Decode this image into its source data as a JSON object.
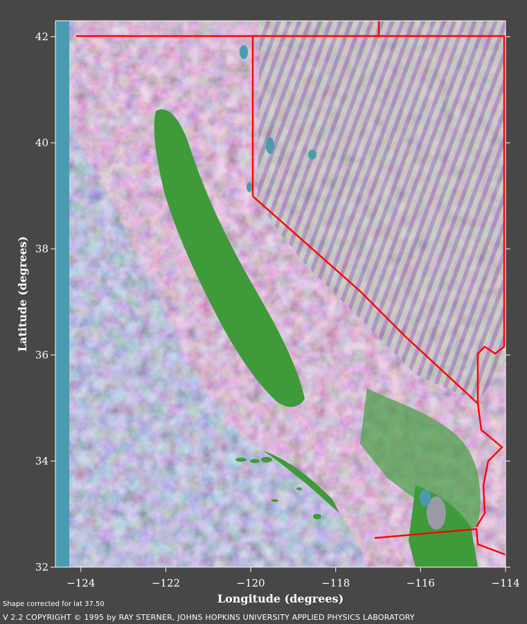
{
  "map": {
    "x_label": "Longitude (degrees)",
    "y_label": "Latitude (degrees)",
    "lon_range": [
      -124.6,
      -114.0
    ],
    "lat_range": [
      32.0,
      42.3
    ],
    "x_ticks": [
      {
        "value": -124,
        "label": "−124"
      },
      {
        "value": -122,
        "label": "−122"
      },
      {
        "value": -120,
        "label": "−120"
      },
      {
        "value": -118,
        "label": "−118"
      },
      {
        "value": -116,
        "label": "−116"
      },
      {
        "value": -114,
        "label": "−114"
      }
    ],
    "y_ticks": [
      {
        "value": 42,
        "label": "42"
      },
      {
        "value": 40,
        "label": "40"
      },
      {
        "value": 38,
        "label": "38"
      },
      {
        "value": 36,
        "label": "36"
      },
      {
        "value": 34,
        "label": "34"
      },
      {
        "value": 32,
        "label": "32"
      }
    ],
    "colors": {
      "ocean": "#4a9bb0",
      "lowland": "#3f9a3a",
      "border": "#ff0000",
      "background": "#474747"
    }
  },
  "footer": {
    "note": "Shape corrected for lat 37.50",
    "copyright": "V 2.2   COPYRIGHT © 1995 by RAY STERNER, JOHNS HOPKINS UNIVERSITY APPLIED PHYSICS LABORATORY"
  }
}
